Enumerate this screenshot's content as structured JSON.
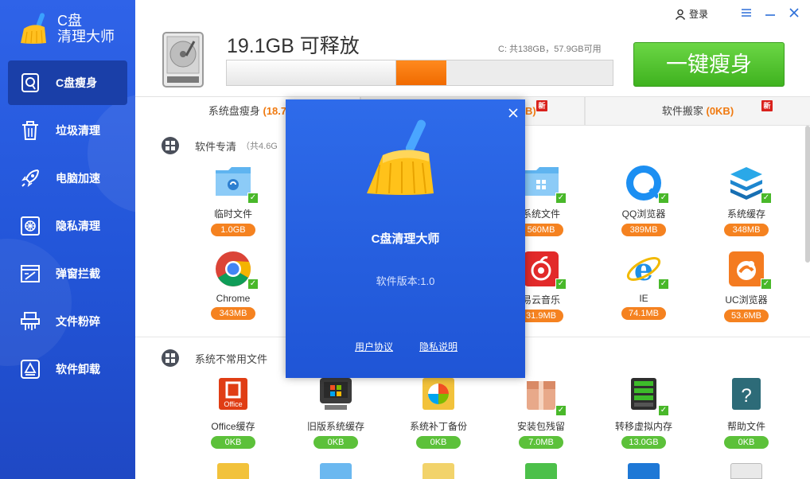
{
  "app": {
    "title_line1": "C盘",
    "title_line2": "清理大师"
  },
  "sidebar": {
    "items": [
      {
        "label": "C盘瘦身",
        "icon": "disk-slim-icon"
      },
      {
        "label": "垃圾清理",
        "icon": "trash-icon"
      },
      {
        "label": "电脑加速",
        "icon": "rocket-icon"
      },
      {
        "label": "隐私清理",
        "icon": "privacy-icon"
      },
      {
        "label": "弹窗拦截",
        "icon": "popup-block-icon"
      },
      {
        "label": "文件粉碎",
        "icon": "shredder-icon"
      },
      {
        "label": "软件卸载",
        "icon": "uninstall-icon"
      }
    ]
  },
  "titlebar": {
    "login_label": "登录"
  },
  "header": {
    "free_text": "19.1GB 可释放",
    "disk_info": "C: 共138GB，57.9GB可用",
    "slim_button": "一键瘦身",
    "used_fraction": 0.44,
    "selected_fraction": 0.13
  },
  "tabs": [
    {
      "label": "系统盘瘦身",
      "value": "(18.7"
    },
    {
      "label": "",
      "value": "B)"
    },
    {
      "label": "软件搬家",
      "value": "(0KB)"
    }
  ],
  "badges": {
    "new": "新"
  },
  "sections": {
    "software": {
      "title": "软件专清",
      "sub": "（共4.6G"
    },
    "system": {
      "title": "系统不常用文件"
    }
  },
  "software_items": [
    {
      "label": "临时文件",
      "size": "1.0GB",
      "icon": "temp-folder-icon"
    },
    {
      "label": "系统文件",
      "size": "560MB",
      "icon": "system-folder-icon"
    },
    {
      "label": "QQ浏览器",
      "size": "389MB",
      "icon": "qq-browser-icon"
    },
    {
      "label": "系统缓存",
      "size": "348MB",
      "icon": "system-cache-icon"
    },
    {
      "label": "Chrome",
      "size": "343MB",
      "icon": "chrome-icon"
    },
    {
      "label": "易云音乐",
      "size": "31.9MB",
      "icon": "netease-music-icon"
    },
    {
      "label": "IE",
      "size": "74.1MB",
      "icon": "ie-icon"
    },
    {
      "label": "UC浏览器",
      "size": "53.6MB",
      "icon": "uc-browser-icon"
    }
  ],
  "system_items": [
    {
      "label": "Office缓存",
      "size": "0KB",
      "icon": "office-icon"
    },
    {
      "label": "旧版系统缓存",
      "size": "0KB",
      "icon": "old-system-icon"
    },
    {
      "label": "系统补丁备份",
      "size": "0KB",
      "icon": "patch-backup-icon"
    },
    {
      "label": "安装包残留",
      "size": "7.0MB",
      "icon": "installer-icon"
    },
    {
      "label": "转移虚拟内存",
      "size": "13.0GB",
      "icon": "virtual-memory-icon"
    },
    {
      "label": "帮助文件",
      "size": "0KB",
      "icon": "help-file-icon"
    }
  ],
  "dialog": {
    "title": "C盘清理大师",
    "version": "软件版本:1.0",
    "user_agreement": "用户协议",
    "privacy_statement": "隐私说明"
  },
  "colors": {
    "sidebar_blue": "#2659dc",
    "accent_orange": "#f58220",
    "accent_green": "#49b82a",
    "dialog_blue": "#2660e0"
  }
}
